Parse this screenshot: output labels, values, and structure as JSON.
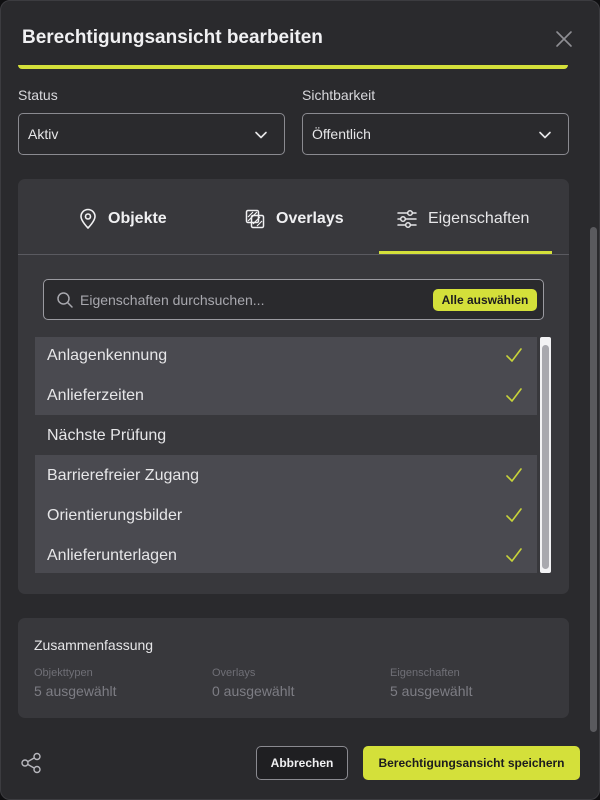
{
  "dialog": {
    "title": "Berechtigungsansicht bearbeiten"
  },
  "status": {
    "label": "Status",
    "value": "Aktiv"
  },
  "visibility": {
    "label": "Sichtbarkeit",
    "value": "Öffentlich"
  },
  "tabs": [
    {
      "label": "Objekte",
      "icon": "map-pin-icon",
      "active": false
    },
    {
      "label": "Overlays",
      "icon": "layers-icon",
      "active": false
    },
    {
      "label": "Eigenschaften",
      "icon": "sliders-icon",
      "active": true
    }
  ],
  "search": {
    "placeholder": "Eigenschaften durchsuchen...",
    "select_all": "Alle auswählen"
  },
  "properties": [
    {
      "label": "Anlagenkennung",
      "selected": true
    },
    {
      "label": "Anlieferzeiten",
      "selected": true
    },
    {
      "label": "Nächste Prüfung",
      "selected": false
    },
    {
      "label": "Barrierefreier Zugang",
      "selected": true
    },
    {
      "label": "Orientierungsbilder",
      "selected": true
    },
    {
      "label": "Anlieferunterlagen",
      "selected": true
    }
  ],
  "summary": {
    "title": "Zusammenfassung",
    "items": [
      {
        "label": "Objekttypen",
        "value": "5 ausgewählt"
      },
      {
        "label": "Overlays",
        "value": "0 ausgewählt"
      },
      {
        "label": "Eigenschaften",
        "value": "5 ausgewählt"
      }
    ]
  },
  "footer": {
    "cancel": "Abbrechen",
    "save": "Berechtigungsansicht speichern"
  },
  "colors": {
    "accent": "#d4e03a",
    "background": "#2a2a2d",
    "panel": "#38383c"
  }
}
